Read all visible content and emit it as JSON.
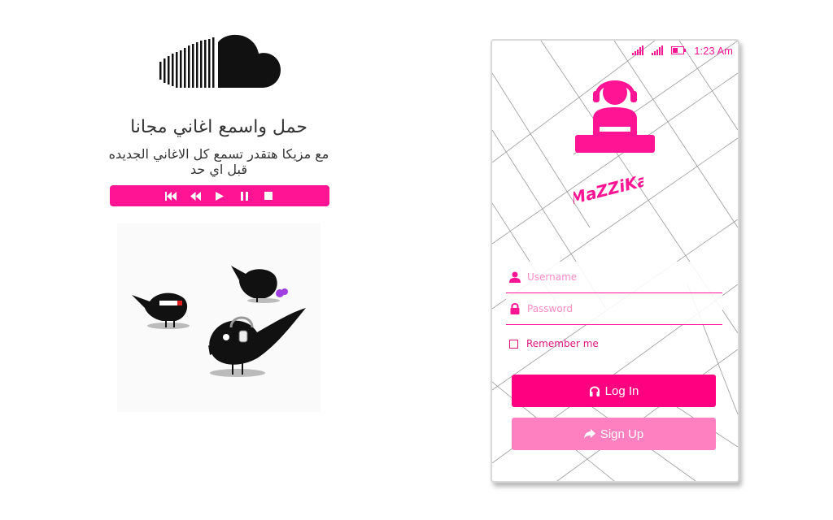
{
  "left": {
    "headline": "حمل واسمع اغاني مجانا",
    "subline": "مع مزيكا هتقدر تسمع كل الاغاني الجديده قبل اي حد",
    "player_controls": [
      "first-icon",
      "rewind-icon",
      "play-icon",
      "pause-icon",
      "stop-icon"
    ]
  },
  "phone": {
    "status": {
      "time": "1:23 Am"
    },
    "brand": "MaZZiKa",
    "form": {
      "username_placeholder": "Username",
      "password_placeholder": "Password",
      "remember_label": "Remember me"
    },
    "buttons": {
      "login_label": "Log In",
      "signup_label": "Sign Up"
    }
  },
  "colors": {
    "accent": "#ff1493",
    "login_button": "#ff0080",
    "signup_button": "#ff80c0"
  }
}
